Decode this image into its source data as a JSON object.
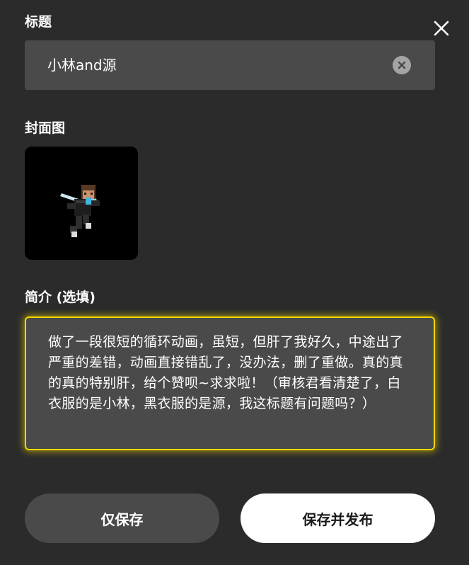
{
  "dialog": {
    "close_icon": "close-icon"
  },
  "title_section": {
    "label": "标题",
    "value": "小林and源",
    "clear_icon": "clear-circle-icon"
  },
  "cover_section": {
    "label": "封面图"
  },
  "intro_section": {
    "label": "简介 (选填)",
    "value": "做了一段很短的循环动画，虽短，但肝了我好久，中途出了严重的差错，动画直接错乱了，没办法，删了重做。真的真的真的特别肝，给个赞呗~求求啦！（审核君看清楚了，白衣服的是小林，黑衣服的是源，我这标题有问题吗？）",
    "focus_color": "#f5d800"
  },
  "actions": {
    "save_only_label": "仅保存",
    "save_publish_label": "保存并发布"
  },
  "colors": {
    "background": "#2b2b2b",
    "field": "#4a4a4a",
    "accent": "#f5d800"
  }
}
